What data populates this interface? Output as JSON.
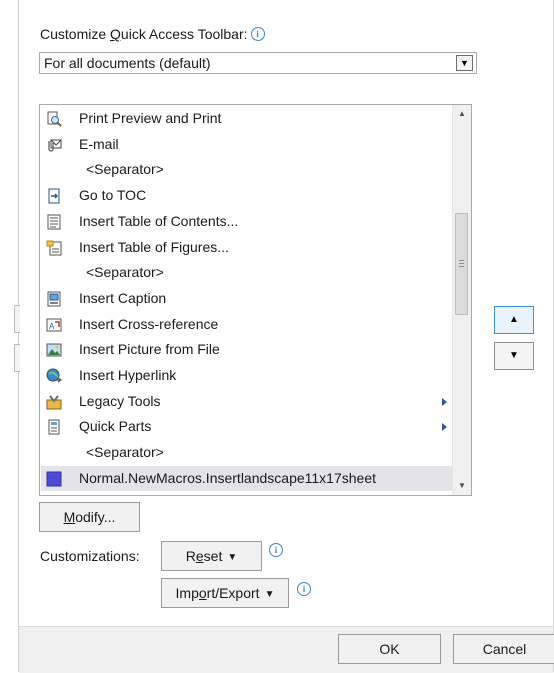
{
  "customize": {
    "label_prefix": "Customize ",
    "label_underlined": "Q",
    "label_suffix": "uick Access Toolbar:",
    "info_glyph": "i",
    "dropdown_value": "For all documents (default)",
    "dropdown_arrow": "▼"
  },
  "commands": [
    {
      "label": "Print Preview and Print",
      "icon": "print-preview-icon",
      "separator": false,
      "submenu": false
    },
    {
      "label": "E-mail",
      "icon": "email-attachment-icon",
      "separator": false,
      "submenu": false
    },
    {
      "label": "<Separator>",
      "icon": "",
      "separator": true,
      "submenu": false
    },
    {
      "label": "Go to TOC",
      "icon": "goto-toc-icon",
      "separator": false,
      "submenu": false
    },
    {
      "label": "Insert Table of Contents...",
      "icon": "table-of-contents-icon",
      "separator": false,
      "submenu": false
    },
    {
      "label": "Insert Table of Figures...",
      "icon": "table-of-figures-icon",
      "separator": false,
      "submenu": false
    },
    {
      "label": "<Separator>",
      "icon": "",
      "separator": true,
      "submenu": false
    },
    {
      "label": "Insert Caption",
      "icon": "insert-caption-icon",
      "separator": false,
      "submenu": false
    },
    {
      "label": "Insert Cross-reference",
      "icon": "cross-reference-icon",
      "separator": false,
      "submenu": false
    },
    {
      "label": "Insert Picture from File",
      "icon": "picture-icon",
      "separator": false,
      "submenu": false
    },
    {
      "label": "Insert Hyperlink",
      "icon": "hyperlink-icon",
      "separator": false,
      "submenu": false
    },
    {
      "label": "Legacy Tools",
      "icon": "legacy-tools-icon",
      "separator": false,
      "submenu": true
    },
    {
      "label": "Quick Parts",
      "icon": "quick-parts-icon",
      "separator": false,
      "submenu": true
    },
    {
      "label": "<Separator>",
      "icon": "",
      "separator": true,
      "submenu": false
    },
    {
      "label": "Normal.NewMacros.Insertlandscape11x17sheet",
      "icon": "macro-icon",
      "separator": false,
      "submenu": false,
      "selected": true
    }
  ],
  "scrollbar": {
    "up_glyph": "▲",
    "down_glyph": "▼"
  },
  "reorder": {
    "up_glyph": "▲",
    "down_glyph": "▼"
  },
  "modify": {
    "underlined": "M",
    "rest": "odify..."
  },
  "customizations": {
    "label": "Customizations:",
    "reset_pre": "R",
    "reset_underlined": "e",
    "reset_post": "set",
    "import_pre": "Imp",
    "import_underlined": "o",
    "import_post": "rt/Export",
    "caret": "▼"
  },
  "footer": {
    "ok": "OK",
    "cancel": "Cancel"
  },
  "colors": {
    "accent": "#3c8fd9",
    "selected_row": "#e4e4e8",
    "macro": "#4b4bd8"
  }
}
